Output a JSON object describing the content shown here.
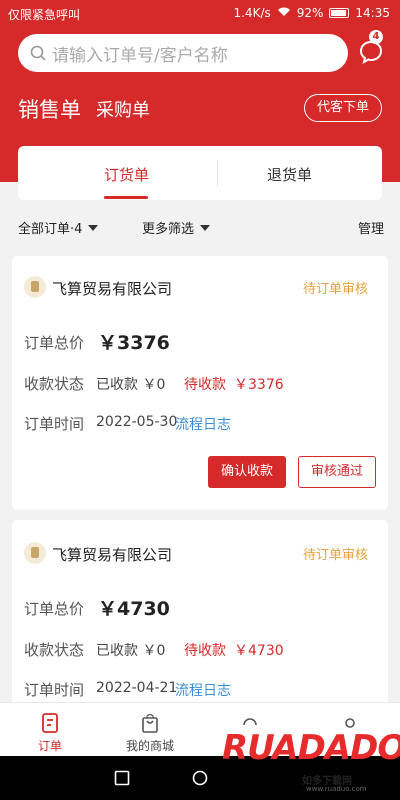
{
  "status_bar": {
    "carrier": "仅限紧急呼叫",
    "speed": "1.4K/s",
    "battery": "92%",
    "time": "14:35"
  },
  "search": {
    "placeholder": "请输入订单号/客户名称"
  },
  "message": {
    "badge": "4"
  },
  "top_tabs": [
    {
      "label": "销售单",
      "active": true
    },
    {
      "label": "采购单",
      "active": false
    }
  ],
  "proxy_order_label": "代客下单",
  "order_tabs": [
    {
      "label": "订货单",
      "active": true
    },
    {
      "label": "退货单",
      "active": false
    }
  ],
  "filters": {
    "all_orders": "全部订单·4",
    "more": "更多筛选",
    "manage": "管理"
  },
  "labels": {
    "total": "订单总价",
    "payment_status": "收款状态",
    "order_time": "订单时间"
  },
  "orders": [
    {
      "company": "飞算贸易有限公司",
      "status": "待订单审核",
      "total": "￥3376",
      "received": "已收款 ￥0",
      "pending_label": "待收款",
      "pending": "￥3376",
      "date": "2022-05-30",
      "log_link": "流程日志",
      "confirm_btn": "确认收款",
      "approve_btn": "审核通过"
    },
    {
      "company": "飞算贸易有限公司",
      "status": "待订单审核",
      "total": "￥4730",
      "received": "已收款 ￥0",
      "pending_label": "待收款",
      "pending": "￥4730",
      "date": "2022-04-21",
      "log_link": "流程日志"
    }
  ],
  "bottom_nav": [
    {
      "label": "订单",
      "icon": "order-icon",
      "active": true
    },
    {
      "label": "我的商城",
      "icon": "shop-bag-icon",
      "active": false
    }
  ],
  "watermark": {
    "brand": "RUADADO",
    "sub": "如多下载网",
    "url": "www.ruaduo.com"
  },
  "colors": {
    "primary": "#d62a2a",
    "warning": "#e6a23c",
    "link": "#3a8fd6"
  }
}
